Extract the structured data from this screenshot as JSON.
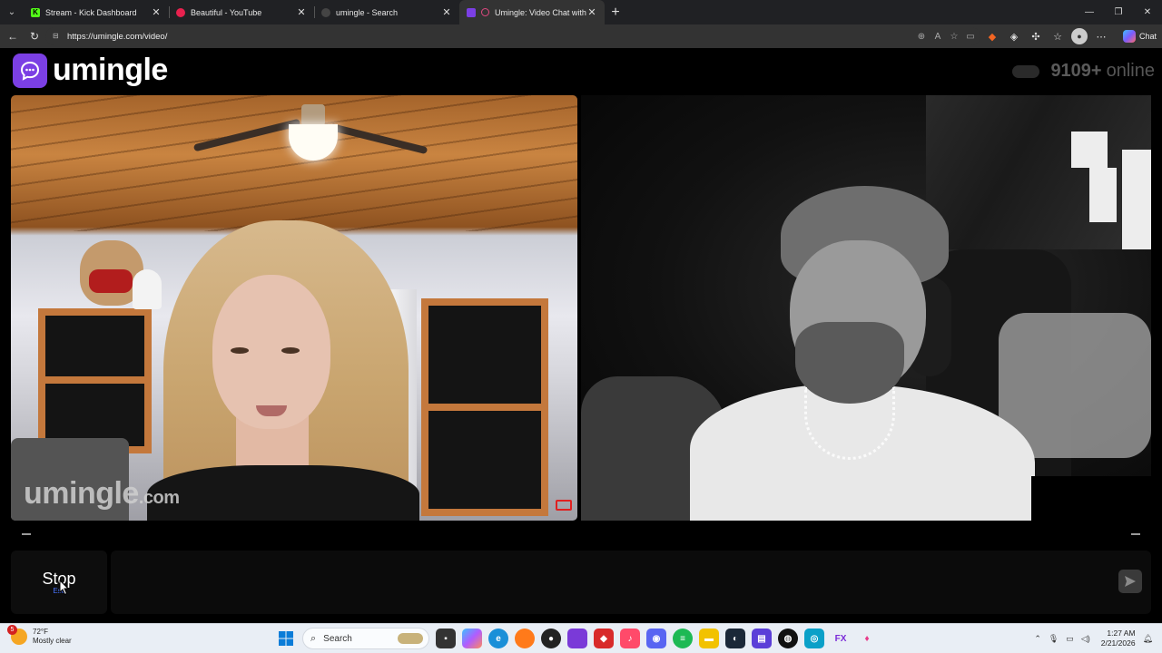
{
  "browser": {
    "tabs": [
      {
        "title": "Stream - Kick Dashboard",
        "favicon_color": "#53fc18",
        "favicon_text": "K",
        "active": false
      },
      {
        "title": "Beautiful - YouTube",
        "favicon_color": "#e8214e",
        "favicon_text": "",
        "active": false
      },
      {
        "title": "umingle - Search",
        "favicon_color": "#444444",
        "favicon_text": "",
        "active": false
      },
      {
        "title": "Umingle: Video Chat with Stra",
        "favicon_color": "#7b3fe4",
        "favicon_text": "",
        "active": true
      }
    ],
    "url": "https://umingle.com/video/",
    "copilot_label": "Chat"
  },
  "site": {
    "logo_text": "umingle",
    "brand_color": "#7b3fe4",
    "online_count": "9109+",
    "online_label": "online",
    "watermark_main": "umingle",
    "watermark_domain": ".com"
  },
  "controls": {
    "stop_label": "Stop",
    "stop_hint": "Esc",
    "chat_placeholder": ""
  },
  "taskbar": {
    "weather_badge": "5",
    "weather_temp": "72°F",
    "weather_desc": "Mostly clear",
    "search_label": "Search",
    "time": "1:27 AM",
    "date": "2/21/2026"
  }
}
